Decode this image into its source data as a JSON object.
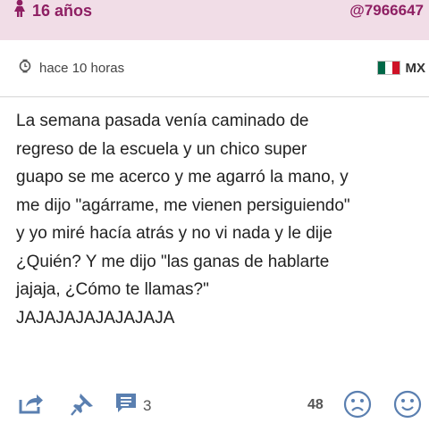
{
  "header": {
    "age": "16 años",
    "handle": "@7966647"
  },
  "meta": {
    "time": "hace 10 horas",
    "country_code": "MX",
    "flag_colors": [
      "#006847",
      "#ffffff",
      "#ce1126"
    ]
  },
  "post": {
    "lines": [
      "La semana pasada venía caminado de",
      "regreso de la escuela y un chico super",
      "guapo se me acerco y me agarró la mano, y",
      "me dijo \"agárrame, me vienen persiguiendo\"",
      "y yo miré hacía atrás y no vi nada y le dije",
      "¿Quién? Y me dijo \"las ganas de hablarte",
      "jajaja, ¿Cómo te llamas?\"",
      "JAJAJAJAJAJAJAJA"
    ]
  },
  "toolbar": {
    "comment_count": "3",
    "score": "48"
  },
  "icons": {
    "age": "female-icon",
    "time": "clock-icon",
    "share": "share-icon",
    "pin": "pin-icon",
    "comment": "comment-icon",
    "sad": "sad-face-icon",
    "happy": "happy-face-icon"
  },
  "colors": {
    "header_bg": "#f1dde7",
    "accent": "#8e1f63",
    "icon": "#5a7fb0"
  }
}
